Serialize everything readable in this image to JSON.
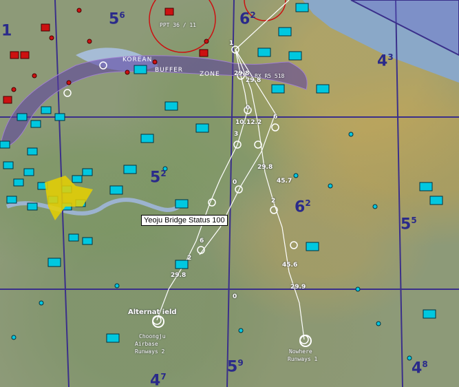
{
  "map": {
    "sectors": [
      {
        "id": "s56",
        "main": "5",
        "sup": "6"
      },
      {
        "id": "s62a",
        "main": "6",
        "sup": "2"
      },
      {
        "id": "s43",
        "main": "4",
        "sup": "3"
      },
      {
        "id": "s52",
        "main": "5",
        "sup": "2"
      },
      {
        "id": "s62b",
        "main": "6",
        "sup": "2"
      },
      {
        "id": "s55",
        "main": "5",
        "sup": "5"
      },
      {
        "id": "s59",
        "main": "5",
        "sup": "9"
      },
      {
        "id": "s48",
        "main": "4",
        "sup": "8"
      },
      {
        "id": "s47",
        "main": "4",
        "sup": "7"
      },
      {
        "id": "s1",
        "main": "1",
        "sup": ""
      }
    ],
    "buffer_zone": {
      "left": "KOREAN",
      "center": "BUFFER",
      "right": "ZONE"
    },
    "labels": {
      "ppt": "PPT 36 / 11",
      "bullseye": "BX R5 518",
      "alternate": "Alternat   ield",
      "choongju_1": "Choongju",
      "choongju_2": "Airbase",
      "choongju_3": "Runways 2",
      "nowhere_1": "Nowhere",
      "nowhere_2": "Runways 1"
    },
    "waypoint_labels": [
      "29.8",
      "29.8",
      "10.12.2",
      "3",
      "0",
      "6",
      "29.8",
      "45.7",
      "2",
      "6",
      "2",
      "29.8",
      "45.6",
      "29.9",
      "0",
      "0",
      "1"
    ],
    "tooltip": "Yeoju Bridge Status 100",
    "colors": {
      "friendly": "#00c8e0",
      "enemy": "#cc1111",
      "route": "#ffffff",
      "sector_line": "#3a2f8a",
      "water": "#8aa8c8"
    }
  }
}
